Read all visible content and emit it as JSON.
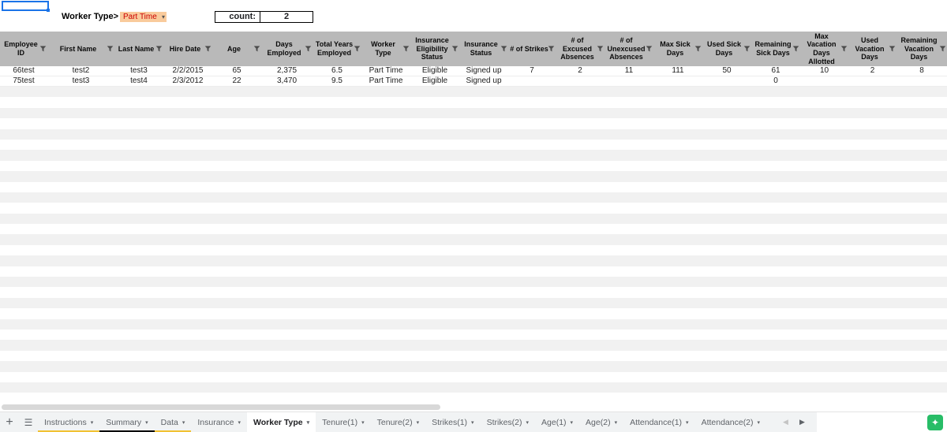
{
  "top": {
    "filter_label": "Worker Type>",
    "filter_value": "Part Time",
    "count_label": "count:",
    "count_value": "2"
  },
  "table": {
    "headers": [
      "Employee ID",
      "First Name",
      "Last Name",
      "Hire Date",
      "Age",
      "Days Employed",
      "Total Years Employed",
      "Worker Type",
      "Insurance Eligibility Status",
      "Insurance Status",
      "# of Strikes",
      "# of Excused Absences",
      "# of Unexcused Absences",
      "Max Sick Days",
      "Used Sick Days",
      "Remaining Sick Days",
      "Max Vacation Days Allotted",
      "Used Vacation Days",
      "Remaining Vacation Days"
    ],
    "rows": [
      [
        "66test",
        "test2",
        "test3",
        "2/2/2015",
        "65",
        "2,375",
        "6.5",
        "Part Time",
        "Eligible",
        "Signed up",
        "7",
        "2",
        "11",
        "111",
        "50",
        "61",
        "10",
        "2",
        "8"
      ],
      [
        "75test",
        "test3",
        "test4",
        "2/3/2012",
        "22",
        "3,470",
        "9.5",
        "Part Time",
        "Eligible",
        "Signed up",
        "",
        "",
        "",
        "",
        "",
        "0",
        "",
        "",
        ""
      ]
    ]
  },
  "tabbar": {
    "tabs": [
      {
        "label": "Instructions",
        "active": false,
        "color": "#f1c232"
      },
      {
        "label": "Summary",
        "active": false,
        "color": "#000000"
      },
      {
        "label": "Data",
        "active": false,
        "color": "#f1c232"
      },
      {
        "label": "Insurance",
        "active": false
      },
      {
        "label": "Worker Type",
        "active": true
      },
      {
        "label": "Tenure(1)",
        "active": false
      },
      {
        "label": "Tenure(2)",
        "active": false
      },
      {
        "label": "Strikes(1)",
        "active": false
      },
      {
        "label": "Strikes(2)",
        "active": false
      },
      {
        "label": "Age(1)",
        "active": false
      },
      {
        "label": "Age(2)",
        "active": false
      },
      {
        "label": "Attendance(1)",
        "active": false
      },
      {
        "label": "Attendance(2)",
        "active": false
      }
    ]
  },
  "icons": {
    "add": "+",
    "all_sheets": "☰",
    "dropdown": "▾",
    "tab_prev": "◀",
    "tab_next": "▶",
    "explore": "✦"
  },
  "colors": {
    "header_bg": "#b9b9b9",
    "band": "#f1f1f1",
    "filter_bg": "#f9cb9c",
    "filter_text": "#cc0000",
    "selection": "#1a73e8",
    "explore_green": "#28bd67",
    "tab_active_bg": "#ffffff"
  }
}
